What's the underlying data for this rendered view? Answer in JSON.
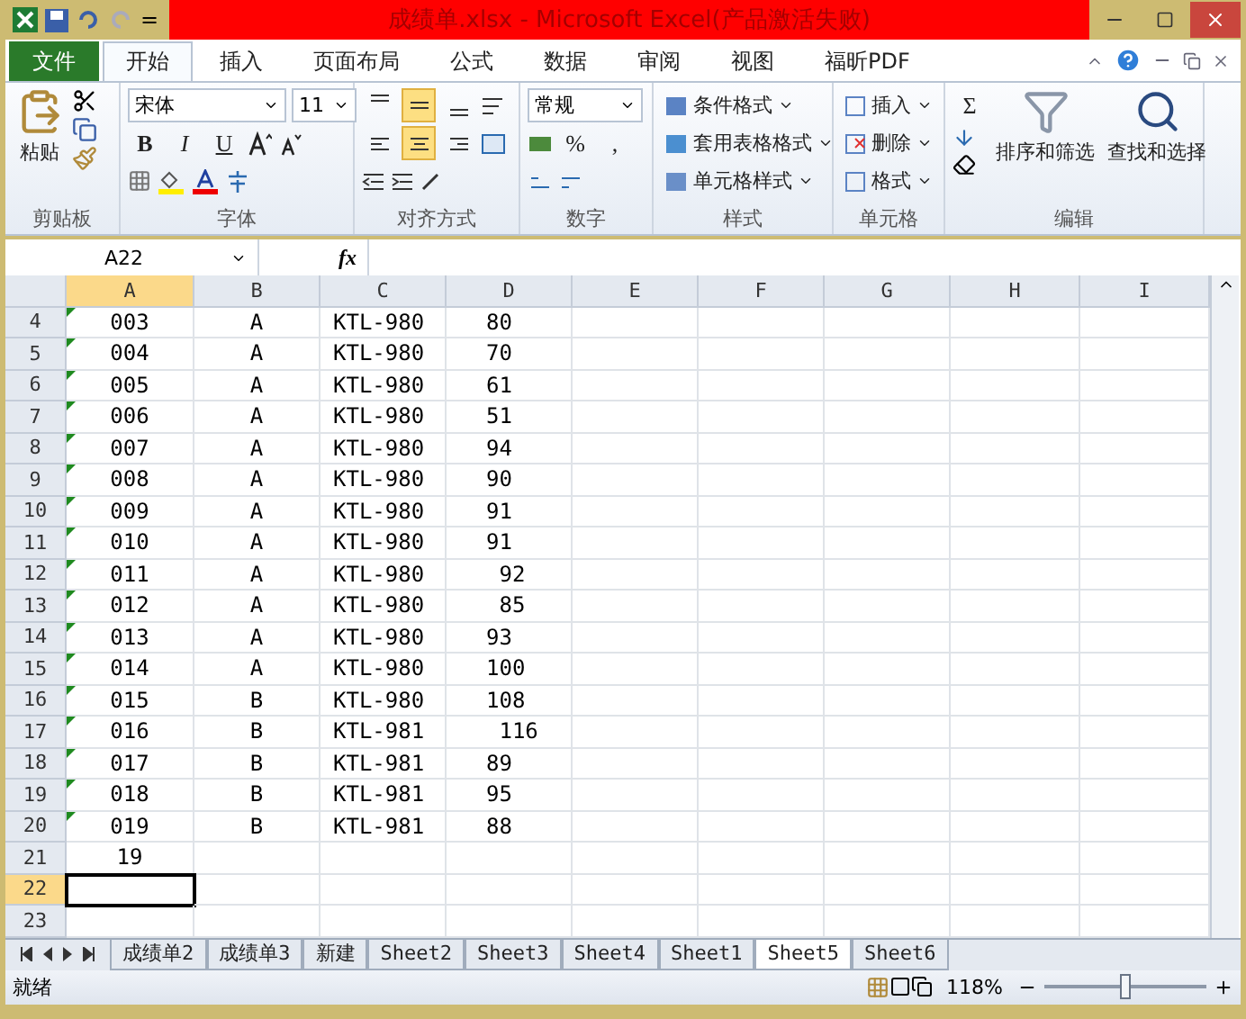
{
  "window": {
    "title": "成绩单.xlsx - Microsoft Excel(产品激活失败)"
  },
  "quick_access": {
    "separator_glyph": "="
  },
  "ribbon_tabs": [
    {
      "label": "文件",
      "kind": "file",
      "selected": false
    },
    {
      "label": "开始",
      "kind": "tab",
      "selected": true
    },
    {
      "label": "插入",
      "kind": "tab",
      "selected": false
    },
    {
      "label": "页面布局",
      "kind": "tab",
      "selected": false
    },
    {
      "label": "公式",
      "kind": "tab",
      "selected": false
    },
    {
      "label": "数据",
      "kind": "tab",
      "selected": false
    },
    {
      "label": "审阅",
      "kind": "tab",
      "selected": false
    },
    {
      "label": "视图",
      "kind": "tab",
      "selected": false
    },
    {
      "label": "福昕PDF",
      "kind": "tab",
      "selected": false
    }
  ],
  "ribbon": {
    "clipboard": {
      "paste": "粘贴",
      "label": "剪贴板"
    },
    "font": {
      "name": "宋体",
      "size": "11",
      "bold": "B",
      "italic": "I",
      "underline": "U",
      "label": "字体"
    },
    "alignment": {
      "top_row": [
        {
          "selected": false
        },
        {
          "selected": true
        },
        {
          "selected": false
        }
      ],
      "bottom_row": [
        {
          "selected": false
        },
        {
          "selected": true
        },
        {
          "selected": false
        }
      ],
      "label": "对齐方式"
    },
    "number": {
      "format": "常规",
      "percent": "%",
      "comma": ",",
      "label": "数字"
    },
    "styles": {
      "items": [
        "条件格式",
        "套用表格格式",
        "单元格样式"
      ],
      "label": "样式"
    },
    "cells": {
      "items": [
        "插入",
        "删除",
        "格式"
      ],
      "label": "单元格"
    },
    "editing": {
      "sum": "Σ",
      "sort": "排序和筛选",
      "find": "查找和选择",
      "label": "编辑"
    }
  },
  "formula_bar": {
    "name_box": "A22",
    "fx": "fx"
  },
  "columns": [
    {
      "label": "A",
      "selected": true
    },
    {
      "label": "B",
      "selected": false
    },
    {
      "label": "C",
      "selected": false
    },
    {
      "label": "D",
      "selected": false
    },
    {
      "label": "E",
      "selected": false
    },
    {
      "label": "F",
      "selected": false
    },
    {
      "label": "G",
      "selected": false
    },
    {
      "label": "H",
      "selected": false
    },
    {
      "label": "I",
      "selected": false
    }
  ],
  "rows": [
    {
      "number": "4",
      "cells": [
        "003",
        "A",
        "KTL-980",
        "80"
      ],
      "flagged": true,
      "selected": false
    },
    {
      "number": "5",
      "cells": [
        "004",
        "A",
        "KTL-980",
        "70"
      ],
      "flagged": true,
      "selected": false
    },
    {
      "number": "6",
      "cells": [
        "005",
        "A",
        "KTL-980",
        "61"
      ],
      "flagged": true,
      "selected": false
    },
    {
      "number": "7",
      "cells": [
        "006",
        "A",
        "KTL-980",
        "51"
      ],
      "flagged": true,
      "selected": false
    },
    {
      "number": "8",
      "cells": [
        "007",
        "A",
        "KTL-980",
        "94"
      ],
      "flagged": true,
      "selected": false
    },
    {
      "number": "9",
      "cells": [
        "008",
        "A",
        "KTL-980",
        "90"
      ],
      "flagged": true,
      "selected": false
    },
    {
      "number": "10",
      "cells": [
        "009",
        "A",
        "KTL-980",
        "91"
      ],
      "flagged": true,
      "selected": false
    },
    {
      "number": "11",
      "cells": [
        "010",
        "A",
        "KTL-980",
        "91"
      ],
      "flagged": true,
      "selected": false
    },
    {
      "number": "12",
      "cells": [
        "011",
        "A",
        "KTL-980",
        " 92"
      ],
      "flagged": true,
      "selected": false
    },
    {
      "number": "13",
      "cells": [
        "012",
        "A",
        "KTL-980",
        " 85"
      ],
      "flagged": true,
      "selected": false
    },
    {
      "number": "14",
      "cells": [
        "013",
        "A",
        "KTL-980",
        "93"
      ],
      "flagged": true,
      "selected": false
    },
    {
      "number": "15",
      "cells": [
        "014",
        "A",
        "KTL-980",
        "100"
      ],
      "flagged": true,
      "selected": false
    },
    {
      "number": "16",
      "cells": [
        "015",
        "B",
        "KTL-980",
        "108"
      ],
      "flagged": true,
      "selected": false
    },
    {
      "number": "17",
      "cells": [
        "016",
        "B",
        "KTL-981",
        " 116"
      ],
      "flagged": true,
      "selected": false
    },
    {
      "number": "18",
      "cells": [
        "017",
        "B",
        "KTL-981",
        "89"
      ],
      "flagged": true,
      "selected": false
    },
    {
      "number": "19",
      "cells": [
        "018",
        "B",
        "KTL-981",
        "95"
      ],
      "flagged": true,
      "selected": false
    },
    {
      "number": "20",
      "cells": [
        "019",
        "B",
        "KTL-981",
        "88"
      ],
      "flagged": true,
      "selected": false
    },
    {
      "number": "21",
      "cells": [
        "19",
        null,
        null,
        null
      ],
      "flagged": false,
      "selected": false
    },
    {
      "number": "22",
      "cells": [
        null,
        null,
        null,
        null
      ],
      "flagged": false,
      "selected": true
    },
    {
      "number": "23",
      "cells": [
        null,
        null,
        null,
        null
      ],
      "flagged": false,
      "selected": false
    }
  ],
  "sheet_tabs": [
    {
      "label": "成绩单2",
      "selected": false
    },
    {
      "label": "成绩单3",
      "selected": false
    },
    {
      "label": "新建",
      "selected": false
    },
    {
      "label": "Sheet2",
      "selected": false
    },
    {
      "label": "Sheet3",
      "selected": false
    },
    {
      "label": "Sheet4",
      "selected": false
    },
    {
      "label": "Sheet1",
      "selected": false
    },
    {
      "label": "Sheet5",
      "selected": true
    },
    {
      "label": "Sheet6",
      "selected": false
    }
  ],
  "status_bar": {
    "status": "就绪",
    "zoom": "118%",
    "zoom_level": {
      "level": 0.5
    }
  }
}
